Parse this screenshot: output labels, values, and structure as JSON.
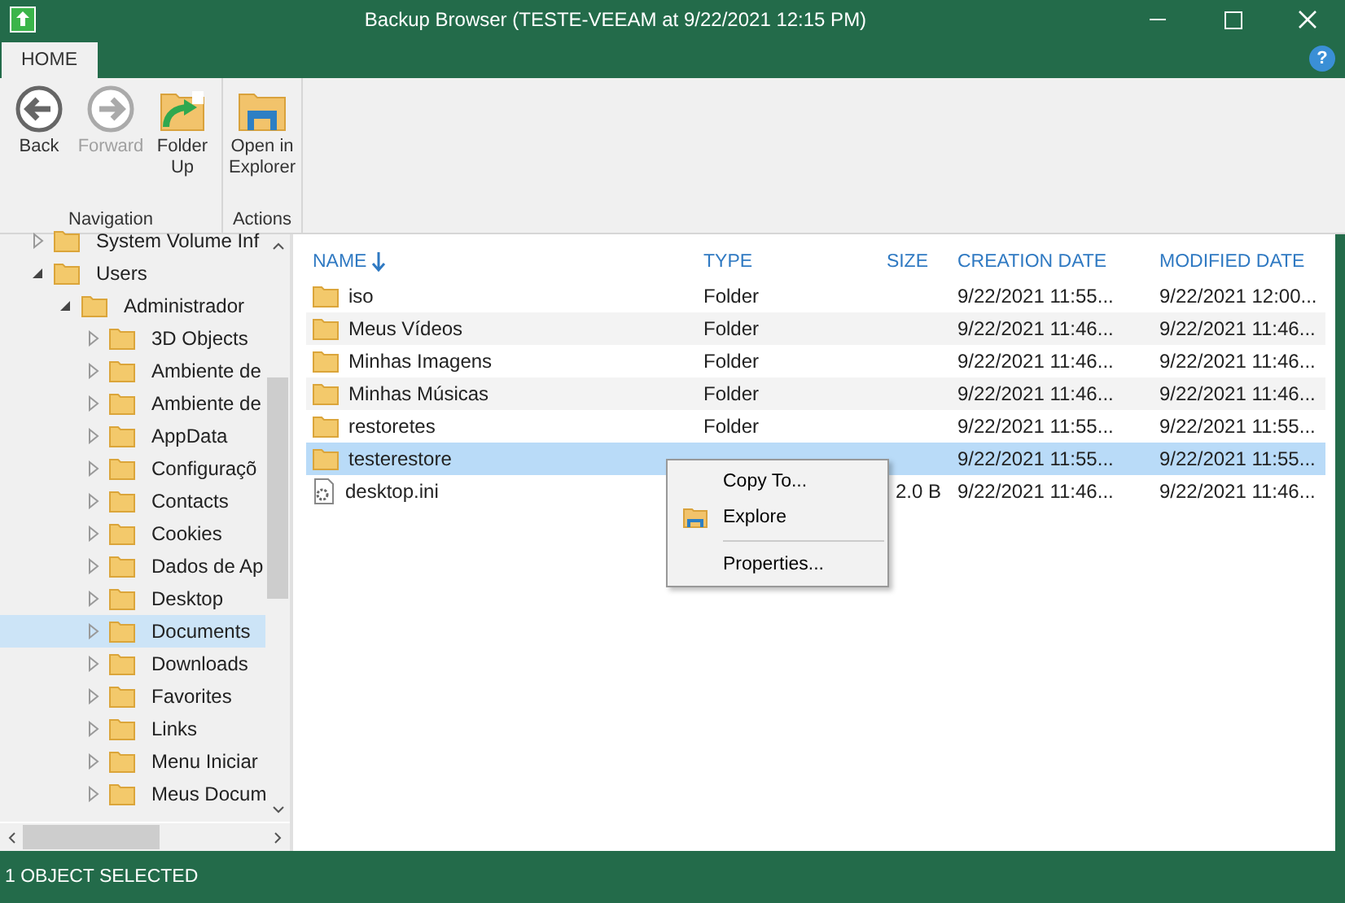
{
  "window": {
    "title": "Backup Browser (TESTE-VEEAM at 9/22/2021 12:15 PM)"
  },
  "tabs": [
    {
      "label": "HOME",
      "selected": true
    }
  ],
  "help": {
    "label": "?"
  },
  "ribbon": {
    "groups": [
      {
        "label": "Navigation",
        "buttons": [
          {
            "kind": "back",
            "label": "Back",
            "disabled": false
          },
          {
            "kind": "forward",
            "label": "Forward",
            "disabled": true
          },
          {
            "kind": "folder-up",
            "label": "Folder Up",
            "disabled": false
          }
        ]
      },
      {
        "label": "Actions",
        "buttons": [
          {
            "kind": "open-explorer",
            "label": "Open in Explorer",
            "disabled": false
          }
        ]
      }
    ]
  },
  "tree": [
    {
      "label": "System Volume Inf",
      "expanded": false,
      "selected": false
    },
    {
      "label": "Users",
      "expanded": true,
      "selected": false,
      "children": [
        {
          "label": "Administrador",
          "expanded": true,
          "selected": false,
          "children": [
            {
              "label": "3D Objects",
              "expanded": false,
              "selected": false
            },
            {
              "label": "Ambiente de",
              "expanded": false,
              "selected": false
            },
            {
              "label": "Ambiente de",
              "expanded": false,
              "selected": false
            },
            {
              "label": "AppData",
              "expanded": false,
              "selected": false
            },
            {
              "label": "Configuraçõ",
              "expanded": false,
              "selected": false
            },
            {
              "label": "Contacts",
              "expanded": false,
              "selected": false
            },
            {
              "label": "Cookies",
              "expanded": false,
              "selected": false
            },
            {
              "label": "Dados de Ap",
              "expanded": false,
              "selected": false
            },
            {
              "label": "Desktop",
              "expanded": false,
              "selected": false
            },
            {
              "label": "Documents",
              "expanded": false,
              "selected": true
            },
            {
              "label": "Downloads",
              "expanded": false,
              "selected": false
            },
            {
              "label": "Favorites",
              "expanded": false,
              "selected": false
            },
            {
              "label": "Links",
              "expanded": false,
              "selected": false
            },
            {
              "label": "Menu Iniciar",
              "expanded": false,
              "selected": false
            },
            {
              "label": "Meus Docum",
              "expanded": false,
              "selected": false
            }
          ]
        }
      ]
    }
  ],
  "table": {
    "columns": [
      {
        "label": "NAME",
        "sorted": true
      },
      {
        "label": "TYPE",
        "sorted": false
      },
      {
        "label": "SIZE",
        "sorted": false
      },
      {
        "label": "CREATION DATE",
        "sorted": false
      },
      {
        "label": "MODIFIED DATE",
        "sorted": false
      }
    ],
    "rows": [
      {
        "kind": "folder",
        "name": "iso",
        "type": "Folder",
        "created": "9/22/2021 11:55...",
        "modified": "9/22/2021 12:00...",
        "selected": false
      },
      {
        "kind": "folder",
        "name": "Meus Vídeos",
        "type": "Folder",
        "created": "9/22/2021 11:46...",
        "modified": "9/22/2021 11:46...",
        "selected": false
      },
      {
        "kind": "folder",
        "name": "Minhas Imagens",
        "type": "Folder",
        "created": "9/22/2021 11:46...",
        "modified": "9/22/2021 11:46...",
        "selected": false
      },
      {
        "kind": "folder",
        "name": "Minhas Músicas",
        "type": "Folder",
        "created": "9/22/2021 11:46...",
        "modified": "9/22/2021 11:46...",
        "selected": false
      },
      {
        "kind": "folder",
        "name": "restoretes",
        "type": "Folder",
        "created": "9/22/2021 11:55...",
        "modified": "9/22/2021 11:55...",
        "selected": false
      },
      {
        "kind": "folder",
        "name": "testerestore",
        "created": "9/22/2021 11:55...",
        "modified": "9/22/2021 11:55...",
        "selected": true
      },
      {
        "kind": "file",
        "name": "desktop.ini",
        "size": "2.0 B",
        "created": "9/22/2021 11:46...",
        "modified": "9/22/2021 11:46...",
        "selected": false
      }
    ]
  },
  "context_menu": {
    "items": [
      {
        "kind": "item",
        "label": "Copy To...",
        "icon": false
      },
      {
        "kind": "item",
        "label": "Explore",
        "icon": true
      },
      {
        "kind": "separator"
      },
      {
        "kind": "item",
        "label": "Properties...",
        "icon": false
      }
    ]
  },
  "status_bar": {
    "text": "1 OBJECT SELECTED"
  }
}
